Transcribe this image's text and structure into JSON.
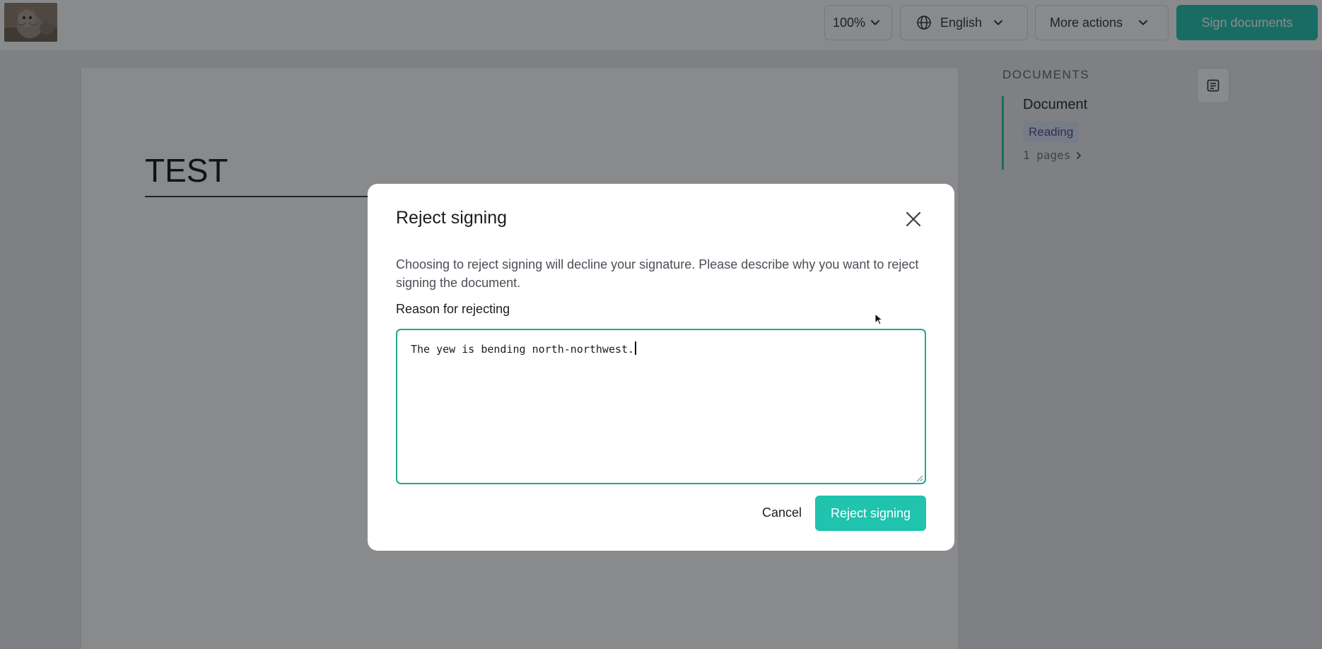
{
  "header": {
    "logo_alt": "kitten logo",
    "zoom": "100%",
    "language": "English",
    "more_actions": "More actions",
    "sign_documents": "Sign documents"
  },
  "document": {
    "title": "TEST"
  },
  "sidebar": {
    "heading": "DOCUMENTS",
    "items": [
      {
        "name": "Document",
        "status": "Reading",
        "pages": "1 pages"
      }
    ]
  },
  "modal": {
    "title": "Reject signing",
    "description": "Choosing to reject signing will decline your signature. Please describe why you want to reject signing the document.",
    "field_label": "Reason for rejecting",
    "reason_value": "The yew is bending north-northwest.",
    "cancel_label": "Cancel",
    "reject_label": "Reject signing"
  },
  "colors": {
    "accent": "#1fc3ae",
    "focus_border": "#1fa892",
    "badge_bg": "#dde3f4",
    "badge_text": "#3b4e9a"
  },
  "icons": [
    "globe-icon",
    "chevron-down-icon",
    "close-icon",
    "outline-icon",
    "chevron-right-icon",
    "resize-grip-icon"
  ]
}
